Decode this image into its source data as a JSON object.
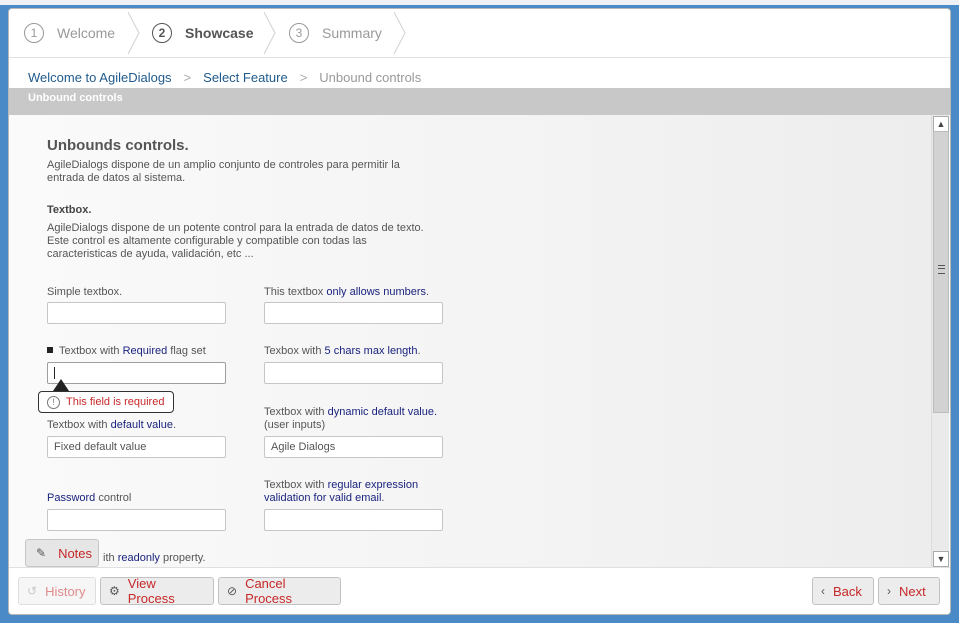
{
  "wizard": {
    "steps": [
      {
        "num": "1",
        "label": "Welcome"
      },
      {
        "num": "2",
        "label": "Showcase"
      },
      {
        "num": "3",
        "label": "Summary"
      }
    ]
  },
  "breadcrumb": {
    "items": [
      "Welcome to AgileDialogs",
      "Select Feature",
      "Unbound controls"
    ],
    "sep": ">"
  },
  "section_bar": "Unbound controls",
  "content": {
    "title": "Unbounds controls.",
    "intro": "AgileDialogs dispone de un amplio conjunto de controles para permitir la entrada de datos al sistema.",
    "textbox_heading": "Textbox.",
    "textbox_desc": "AgileDialogs dispone de un potente control para la entrada de datos de texto. Este control es altamente configurable y compatible con todas las caracteristicas de ayuda, validación, etc ...",
    "fields": {
      "simple_label": "Simple textbox.",
      "numbers_label_a": "This textbox ",
      "numbers_label_b": "only allows numbers",
      "numbers_label_c": ".",
      "required_label_a": "Textbox with ",
      "required_label_b": "Required",
      "required_label_c": " flag set",
      "maxlen_label_a": "Texbox with ",
      "maxlen_label_b": "5 chars max length",
      "maxlen_label_c": ".",
      "default_label_a": "Textbox with ",
      "default_label_b": "default value",
      "default_label_c": ".",
      "default_value": "Fixed default value",
      "dynamic_label_a": "Textbox with ",
      "dynamic_label_b": "dynamic default value.",
      "dynamic_label_c": "(user inputs)",
      "dynamic_value": "Agile Dialogs",
      "password_label_a": "Password",
      "password_label_b": " control",
      "regex_label_a": "Textbox with ",
      "regex_label_b": "regular expression validation for valid email",
      "regex_label_c": ".",
      "readonly_label_a": "ith ",
      "readonly_label_b": "readonly",
      "readonly_label_c": " property."
    },
    "validation_message": "This field is required"
  },
  "notes_label": "Notes",
  "footer": {
    "history": "History",
    "view_process": "View Process",
    "cancel_process": "Cancel Process",
    "back": "Back",
    "next": "Next"
  }
}
